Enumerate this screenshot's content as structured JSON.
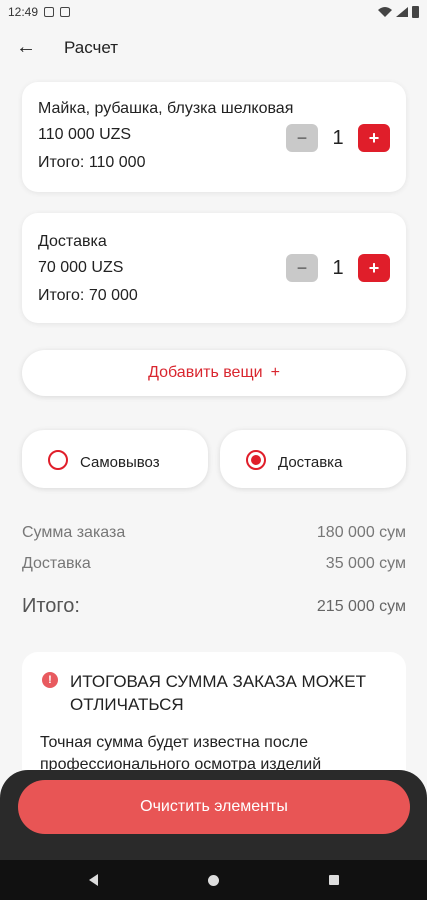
{
  "status": {
    "time": "12:49"
  },
  "header": {
    "title": "Расчет"
  },
  "items": [
    {
      "name": "Майка, рубашка, блузка шелковая",
      "price": "110 000 UZS",
      "total": "Итого: 110 000",
      "qty": "1"
    },
    {
      "name": "Доставка",
      "price": "70 000 UZS",
      "total": "Итого: 70 000",
      "qty": "1"
    }
  ],
  "add_button": {
    "label": "Добавить вещи",
    "icon": "+"
  },
  "delivery_options": [
    {
      "label": "Самовывоз",
      "selected": false
    },
    {
      "label": "Доставка",
      "selected": true
    }
  ],
  "summary": {
    "order_label": "Сумма заказа",
    "order_value": "180 000 сум",
    "delivery_label": "Доставка",
    "delivery_value": "35 000 сум",
    "total_label": "Итого:",
    "total_value": "215 000 сум"
  },
  "warning": {
    "title": "ИТОГОВАЯ СУММА ЗАКАЗА МОЖЕТ ОТЛИЧАТЬСЯ",
    "text": "Точная сумма будет известна после профессионального осмотра изделий"
  },
  "clear_button": {
    "label": "Очистить элементы"
  },
  "colors": {
    "accent": "#e01e2a",
    "clear_button": "#e85555",
    "background": "#f6f6f6"
  }
}
